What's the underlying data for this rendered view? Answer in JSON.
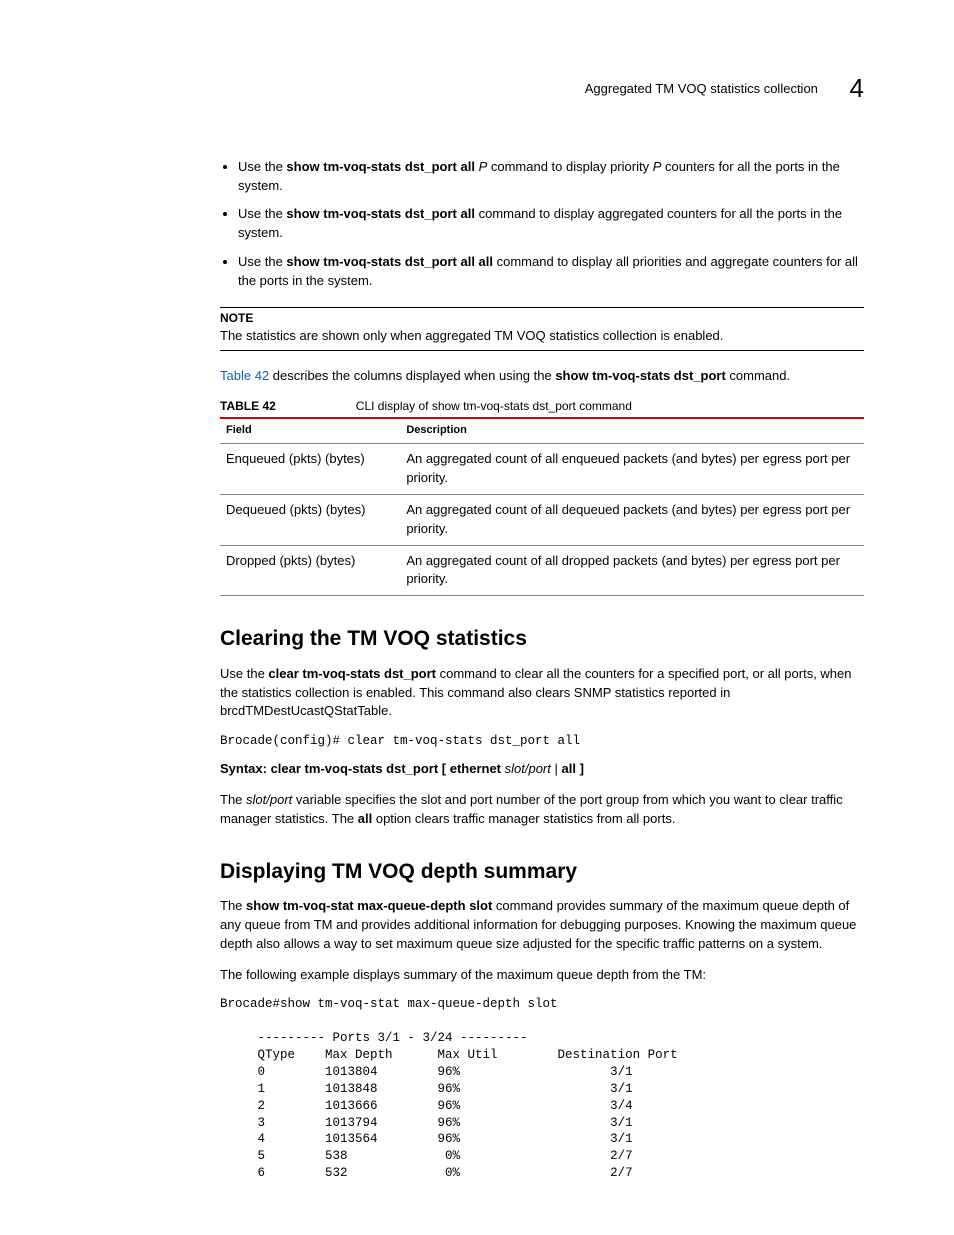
{
  "header": {
    "title": "Aggregated TM VOQ statistics collection",
    "chapter": "4"
  },
  "bullets": [
    {
      "pre": "Use the ",
      "cmd": "show tm-voq-stats dst_port all ",
      "mid1_i": "P",
      "mid2": " command to display priority ",
      "mid3_i": "P",
      "post": " counters for all the ports in the system."
    },
    {
      "pre": "Use the ",
      "cmd": "show tm-voq-stats dst_port all",
      "post": " command to display aggregated counters for all the ports in the system."
    },
    {
      "pre": "Use the ",
      "cmd": "show tm-voq-stats dst_port all all",
      "post": " command to display all priorities and aggregate counters for all the ports in the system."
    }
  ],
  "note": {
    "label": "NOTE",
    "text": "The statistics are shown only when aggregated TM VOQ statistics collection is enabled."
  },
  "intro": {
    "link": "Table 42",
    "rest": " describes the columns displayed when using the ",
    "cmd": "show tm-voq-stats dst_port",
    "end": " command."
  },
  "table": {
    "num": "TABLE 42",
    "caption": "CLI display of show tm-voq-stats dst_port command",
    "head_field": "Field",
    "head_desc": "Description",
    "rows": [
      {
        "f": "Enqueued (pkts) (bytes)",
        "d": "An aggregated count of all enqueued packets (and bytes) per egress port per priority."
      },
      {
        "f": "Dequeued (pkts) (bytes)",
        "d": "An aggregated count of all dequeued packets (and bytes) per egress port per priority."
      },
      {
        "f": "Dropped (pkts) (bytes)",
        "d": "An aggregated count of all dropped packets (and bytes) per egress port per priority."
      }
    ]
  },
  "sec1": {
    "title": "Clearing the TM VOQ statistics",
    "p1a": "Use the ",
    "p1b": "clear tm-voq-stats dst_port",
    "p1c": " command to clear all the counters for a specified port, or all ports, when the statistics collection is enabled. This command also clears SNMP statistics reported in brcdTMDestUcastQStatTable.",
    "code": "Brocade(config)# clear tm-voq-stats dst_port all",
    "syntax_label": "Syntax:  ",
    "syntax_cmd": "clear tm-voq-stats dst_port [ ethernet ",
    "syntax_var": "slot/port",
    "syntax_mid": " | ",
    "syntax_all": "all",
    "syntax_end": " ]",
    "p2a": "The ",
    "p2b": "slot/port",
    "p2c": " variable specifies the slot and port number of the port group from which you want to clear traffic manager statistics. The ",
    "p2d": "all",
    "p2e": " option clears traffic manager statistics from all ports."
  },
  "sec2": {
    "title": "Displaying TM VOQ depth summary",
    "p1a": "The ",
    "p1b": "show tm-voq-stat max-queue-depth slot",
    "p1c": " command provides summary of the maximum queue depth of any queue from TM and provides additional information for debugging purposes. Knowing the maximum queue depth also allows a way to set maximum queue size adjusted for the specific traffic patterns on a system.",
    "p2": "The following example displays summary of the maximum queue depth from the TM:",
    "code": "Brocade#show tm-voq-stat max-queue-depth slot\n\n     --------- Ports 3/1 - 3/24 ---------\n     QType    Max Depth      Max Util        Destination Port\n     0        1013804        96%                    3/1\n     1        1013848        96%                    3/1\n     2        1013666        96%                    3/4\n     3        1013794        96%                    3/1\n     4        1013564        96%                    3/1\n     5        538             0%                    2/7\n     6        532             0%                    2/7"
  }
}
